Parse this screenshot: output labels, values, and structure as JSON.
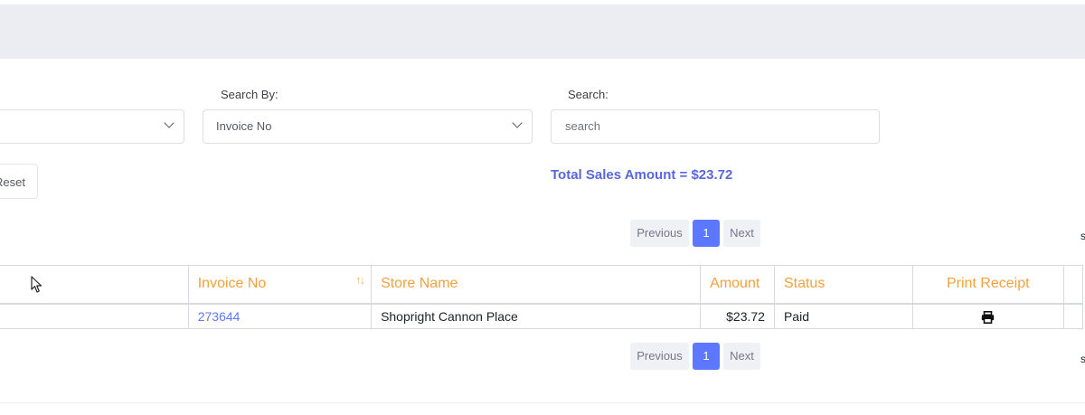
{
  "filters": {
    "search_by_label": "Search By:",
    "search_by_value": "Invoice No",
    "search_label": "Search:",
    "search_placeholder": "search",
    "reset_label": "Reset"
  },
  "total": {
    "text": "Total Sales Amount = $23.72"
  },
  "pagination": {
    "previous": "Previous",
    "current": "1",
    "next": "Next"
  },
  "edge_text": "s",
  "table": {
    "headers": [
      "",
      "Invoice No",
      "Store Name",
      "Amount",
      "Status",
      "Print Receipt"
    ],
    "rows": [
      {
        "invoice_no": "273644",
        "store_name": "Shopright Cannon Place",
        "amount": "$23.72",
        "status": "Paid"
      }
    ]
  },
  "icons": {
    "sort": "sort-arrows-icon",
    "print": "printer-icon",
    "chevron": "chevron-down-icon",
    "cursor": "mouse-cursor-icon"
  },
  "colors": {
    "accent": "#5d78ff",
    "total_text": "#5867dd",
    "header_text": "#f4a03f",
    "topbar": "#ebedf2"
  }
}
